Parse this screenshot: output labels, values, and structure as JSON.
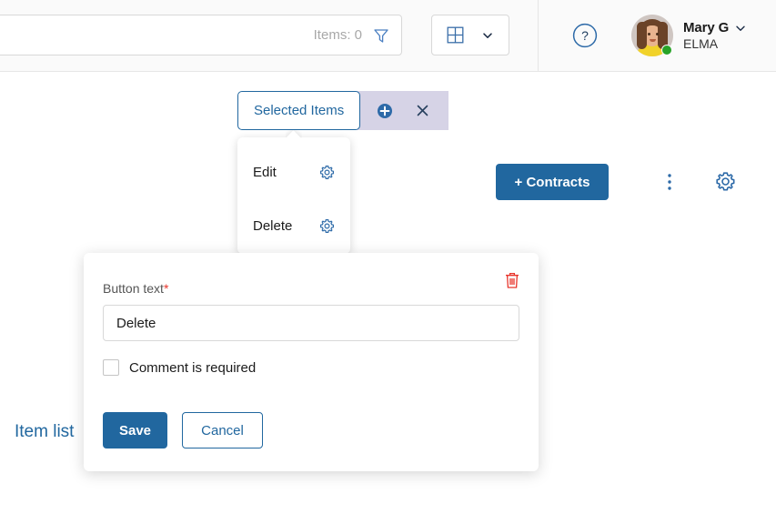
{
  "header": {
    "search": {
      "value": "",
      "placeholder": "",
      "items_count_label": "Items: 0",
      "filter_icon": "funnel-icon"
    },
    "view_switcher": {
      "grid_icon": "grid-view-icon",
      "chevron_icon": "chevron-down-icon"
    },
    "help_icon": "question-circle-icon",
    "user": {
      "name": "Mary G",
      "organization": "ELMA",
      "chevron_icon": "chevron-down-icon",
      "status": "online",
      "status_color": "#27a327",
      "avatar_icon": "user-avatar"
    }
  },
  "toolbar": {
    "selected_tab_label": "Selected Items",
    "add_icon": "plus-circle-icon",
    "close_icon": "close-x-icon",
    "contracts_button_label": "+ Contracts",
    "kebab_icon": "more-vertical-icon",
    "settings_icon": "gear-icon",
    "tab_actions_bg": "#d6d3e6",
    "accent_color": "#21679f"
  },
  "dropdown": {
    "items": [
      {
        "label": "Edit",
        "icon": "gear-icon"
      },
      {
        "label": "Delete",
        "icon": "gear-icon"
      }
    ]
  },
  "page": {
    "item_list_title": "Item list"
  },
  "modal": {
    "delete_icon": "trash-icon",
    "delete_icon_color": "#e8352c",
    "field_label": "Button text",
    "required_marker": "*",
    "button_text_value": "Delete",
    "button_text_placeholder": "",
    "checkbox_label": "Comment is required",
    "checkbox_checked": false,
    "save_label": "Save",
    "cancel_label": "Cancel"
  }
}
